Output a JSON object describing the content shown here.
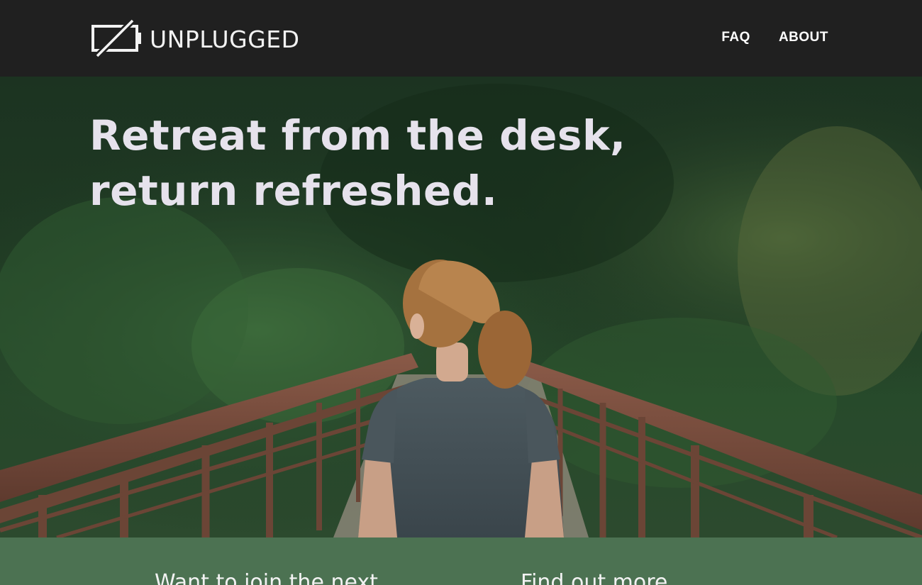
{
  "brand": {
    "name": "UNPLUGGED",
    "icon": "battery-off-icon"
  },
  "nav": {
    "items": [
      {
        "label": "FAQ"
      },
      {
        "label": "ABOUT"
      }
    ]
  },
  "hero": {
    "headline_line1": "Retreat from the desk,",
    "headline_line2": "return refreshed."
  },
  "cta": {
    "left_text": "Want to join the next",
    "right_text": "Find out more"
  },
  "colors": {
    "header_bg": "#202020",
    "headline_text": "#e6e2ec",
    "cta_band_bg": "#4c7252"
  }
}
